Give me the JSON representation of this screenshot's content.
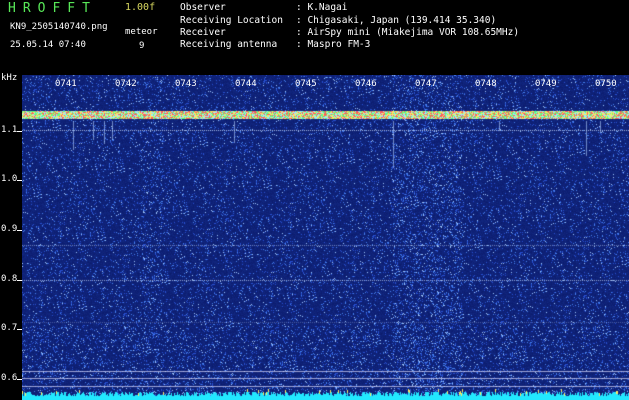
{
  "header": {
    "app_title": "HROFFT",
    "version": "1.00f",
    "file_name": "KN9_2505140740.png",
    "meteor_label": "meteor",
    "meteor_count": "9",
    "timestamp": "25.05.14 07:40",
    "info": [
      {
        "label": "Observer",
        "value": ": K.Nagai"
      },
      {
        "label": "Receiving Location",
        "value": ": Chigasaki, Japan (139.414 35.340)"
      },
      {
        "label": "Receiver",
        "value": ": AirSpy mini (Miakejima VOR 108.65MHz)"
      },
      {
        "label": "Receiving antenna",
        "value": ": Maspro FM-3"
      }
    ]
  },
  "axis": {
    "unit": "kHz",
    "y_ticks": [
      "1.1",
      "1.0",
      "0.9",
      "0.8",
      "0.7",
      "0.6"
    ],
    "time_ticks": [
      "0741",
      "0742",
      "0743",
      "0744",
      "0745",
      "0746",
      "0747",
      "0748",
      "0749",
      "0750"
    ]
  },
  "colors": {
    "background": "#0a1a66",
    "title": "#58e858",
    "version": "#d8d860",
    "text": "#ffffff"
  }
}
